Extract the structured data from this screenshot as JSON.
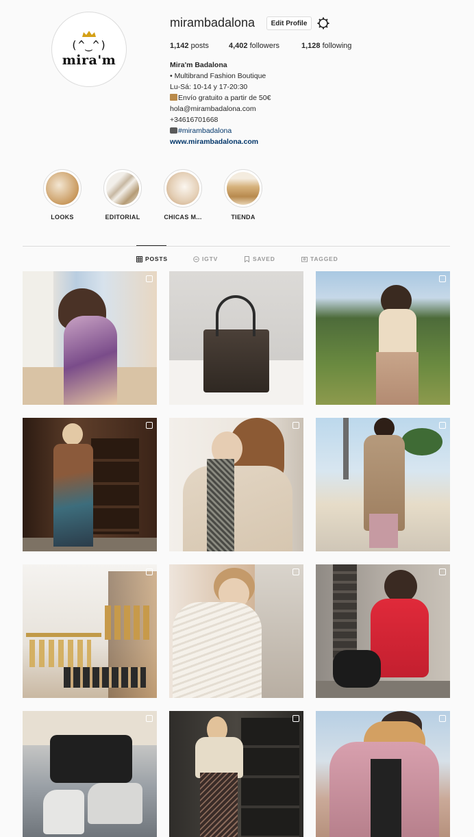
{
  "profile": {
    "avatar_face": "(^‿^)",
    "avatar_brand": "mira'm",
    "username": "mirambadalona",
    "edit_label": "Edit Profile",
    "stats": {
      "posts_count": "1,142",
      "posts_label": "posts",
      "followers_count": "4,402",
      "followers_label": "followers",
      "following_count": "1,128",
      "following_label": "following"
    },
    "bio": {
      "name": "Mira'm Badalona",
      "line1": "• Multibrand Fashion Boutique",
      "line2": "Lu-Sá: 10-14 y 17-20:30",
      "line3": "Envío gratuito a partir de 50€",
      "line4": "hola@mirambadalona.com",
      "line5": "+34616701668",
      "hashtag": "#mirambadalona",
      "website": "www.mirambadalona.com"
    }
  },
  "highlights": [
    {
      "label": "LOOKS",
      "color": "#d8b88d"
    },
    {
      "label": "EDITORIAL",
      "color": "#e8e2d8"
    },
    {
      "label": "CHICAS M...",
      "color": "#e6d6c4"
    },
    {
      "label": "TIENDA",
      "color": "#cfa978"
    }
  ],
  "tabs": [
    {
      "label": "POSTS",
      "icon": "grid-icon",
      "active": true
    },
    {
      "label": "IGTV",
      "icon": "igtv-icon",
      "active": false
    },
    {
      "label": "SAVED",
      "icon": "bookmark-icon",
      "active": false
    },
    {
      "label": "TAGGED",
      "icon": "tag-icon",
      "active": false
    }
  ],
  "colors": {
    "link": "#003569",
    "border": "#dbdbdb",
    "text": "#262626",
    "background": "#fafafa"
  }
}
